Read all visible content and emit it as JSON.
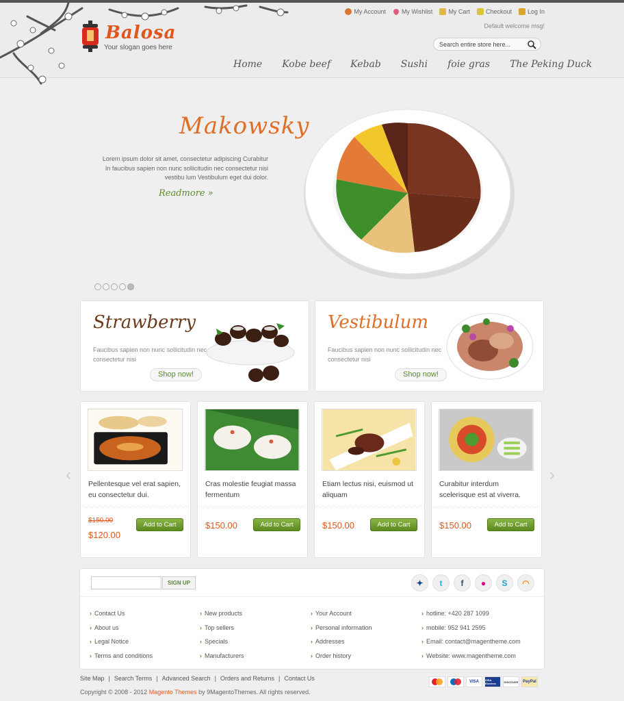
{
  "header": {
    "brand": "Balosa",
    "slogan": "Your slogan goes here",
    "top_links": [
      {
        "label": "My Account",
        "icon": "account-icon"
      },
      {
        "label": "My Wishlist",
        "icon": "heart-icon"
      },
      {
        "label": "My Cart",
        "icon": "cart-icon"
      },
      {
        "label": "Checkout",
        "icon": "checkout-icon"
      },
      {
        "label": "Log In",
        "icon": "lock-icon"
      }
    ],
    "welcome": "Default welcome msg!",
    "search_placeholder": "Search entire store here...",
    "nav": [
      "Home",
      "Kobe beef",
      "Kebab",
      "Sushi",
      "foie gras",
      "The Peking Duck"
    ]
  },
  "slider": {
    "title": "Makowsky",
    "text": "Lorem ipsum dolor sit amet, consectetur adipiscing  Curabitur In faucibus sapien non nunc sollicitudin nec consectetur nisi vestibu lum Vestibulum eget dui dolor.",
    "readmore": "Readmore »",
    "dots": 5,
    "active_dot": 5
  },
  "promos": [
    {
      "title": "Strawberry",
      "text": "Faucibus sapien non nunc sollicitudin nec consectetur nisi",
      "button": "Shop now!"
    },
    {
      "title": "Vestibulum",
      "text": "Faucibus sapien non nunc sollicitudin nec consectetur nisi",
      "button": "Shop now!"
    }
  ],
  "products": [
    {
      "name": "Pellentesque vel erat sapien, eu consectetur dui.",
      "old_price": "$150.00",
      "price": "$120.00",
      "button": "Add to Cart"
    },
    {
      "name": "Cras molestie feugiat massa fermentum",
      "price": "$150.00",
      "button": "Add to Cart"
    },
    {
      "name": "Etiam lectus nisi, euismod ut aliquam",
      "price": "$150.00",
      "button": "Add to Cart"
    },
    {
      "name": "Curabitur interdum scelerisque est at viverra.",
      "price": "$150.00",
      "button": "Add to Cart"
    }
  ],
  "footer": {
    "signup": "SIGN UP",
    "social": [
      "myspace-icon",
      "twitter-icon",
      "facebook-icon",
      "flickr-icon",
      "skype-icon",
      "rss-icon"
    ],
    "col1": [
      "Contact Us",
      "About us",
      "Legal Notice",
      "Terms and conditions"
    ],
    "col2": [
      "New products",
      "Top sellers",
      "Specials",
      "Manufacturers"
    ],
    "col3": [
      "Your Account",
      "Personal information",
      "Addresses",
      "Order history"
    ],
    "col4": [
      "hotline: +420 287 1099",
      "mobile: 952 941 2595",
      "Email: contact@magentheme.com",
      "Website: www.magentheme.com"
    ]
  },
  "bottom": {
    "links": [
      "Site Map",
      "Search Terms",
      "Advanced Search",
      "Orders and Returns",
      "Contact Us"
    ],
    "copyright_pre": "Copyright © 2008 - 2012 ",
    "copyright_link": "Magento Themes",
    "copyright_post": " by 9MagentoThemes. All rights reserved.",
    "payments": [
      "MasterCard",
      "Maestro",
      "VISA",
      "VISA Electron",
      "DISCOVER",
      "PayPal"
    ]
  },
  "colors": {
    "accent": "#e0571d",
    "green": "#5a8c2a",
    "background": "#efefef"
  }
}
